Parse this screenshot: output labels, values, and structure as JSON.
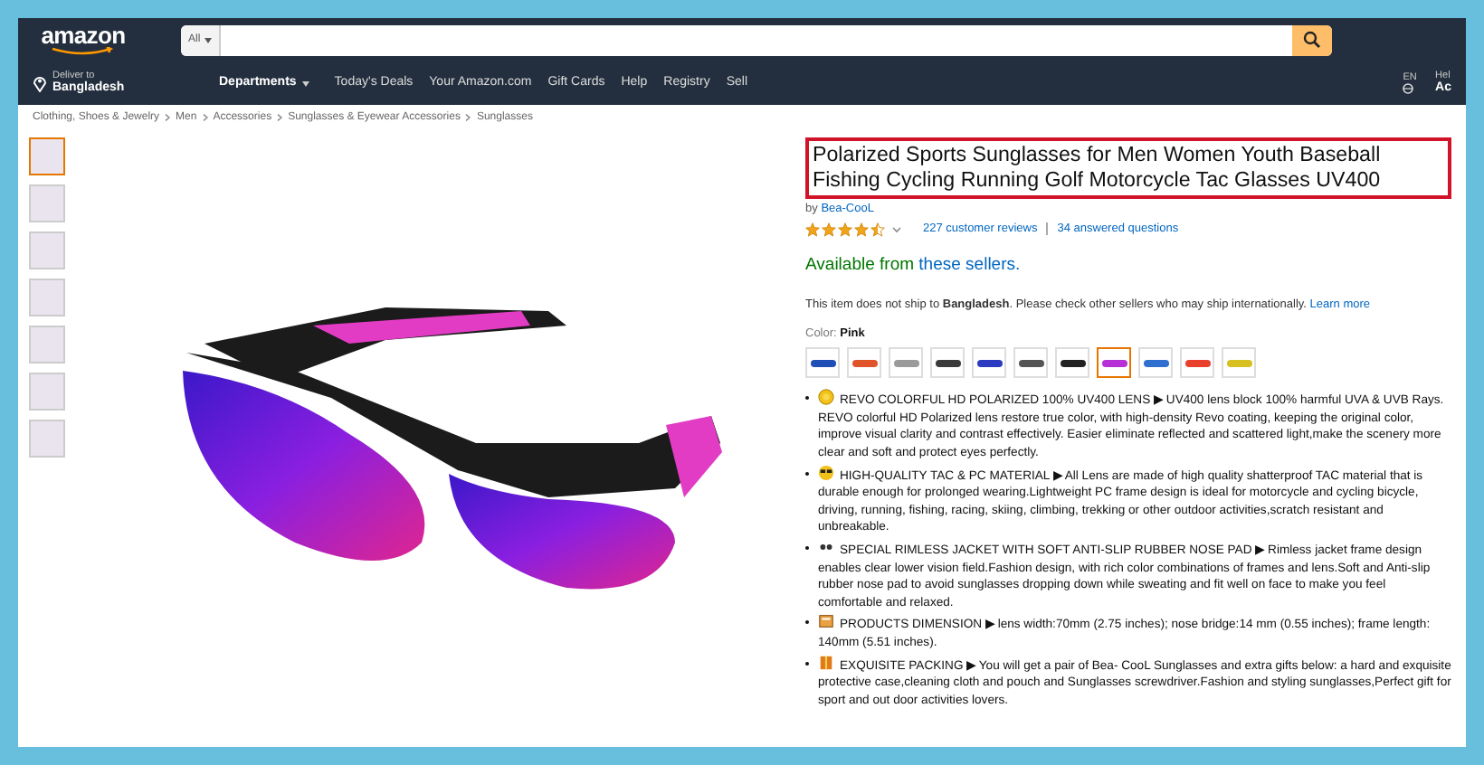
{
  "header": {
    "logo": "amazon",
    "search": {
      "category": "All"
    },
    "deliver": {
      "label": "Deliver to",
      "place": "Bangladesh"
    },
    "departments": "Departments",
    "links": [
      "Today's Deals",
      "Your Amazon.com",
      "Gift Cards",
      "Help",
      "Registry",
      "Sell"
    ],
    "language": "EN",
    "account_line_1": "Hel",
    "account_line_2": "Ac"
  },
  "breadcrumb": [
    "Clothing, Shoes & Jewelry",
    "Men",
    "Accessories",
    "Sunglasses & Eyewear Accessories",
    "Sunglasses"
  ],
  "thumbnails": [
    {
      "selected": true
    },
    {
      "selected": false
    },
    {
      "selected": false
    },
    {
      "selected": false
    },
    {
      "selected": false
    },
    {
      "selected": false
    },
    {
      "selected": false
    }
  ],
  "product": {
    "title": "Polarized Sports Sunglasses for Men Women Youth Baseball Fishing Cycling Running Golf Motorcycle Tac Glasses UV400",
    "title_highlighted": true,
    "brand_prefix": "by",
    "brand": "Bea-CooL",
    "stars": 4.5,
    "reviews": "227 customer reviews",
    "questions": "34 answered questions",
    "availability": "Available from",
    "sellers_link": "these sellers.",
    "shipping_note": "This item does not ship to **Bangladesh**. Please check other sellers who may ship internationally.",
    "learn_more": "Learn more",
    "color_label": "Color:",
    "color_value": "Pink",
    "swatches": [
      {
        "color": "#1f4fb5",
        "selected": false
      },
      {
        "color": "#e0542a",
        "selected": false
      },
      {
        "color": "#9a9a9a",
        "selected": false
      },
      {
        "color": "#3a3a3a",
        "selected": false
      },
      {
        "color": "#2a3bc0",
        "selected": false
      },
      {
        "color": "#555555",
        "selected": false
      },
      {
        "color": "#222222",
        "selected": false
      },
      {
        "color": "#b72fd6",
        "selected": true
      },
      {
        "color": "#2f6fd0",
        "selected": false
      },
      {
        "color": "#e8402c",
        "selected": false
      },
      {
        "color": "#d8c020",
        "selected": false
      }
    ],
    "bullets": [
      {
        "kind": "sun",
        "heading": "REVO COLORFUL HD POLARIZED 100% UV400 LENS",
        "arrow": "▶",
        "text": "UV400 lens block 100% harmful UVA & UVB Rays. REVO colorful HD Polarized lens restore true color, with high-density Revo coating, keeping the original color, improve visual clarity and contrast effectively. Easier eliminate reflected and scattered light,make the scenery more clear and soft and protect eyes perfectly."
      },
      {
        "kind": "glasses",
        "heading": "HIGH-QUALITY TAC & PC MATERIAL",
        "arrow": "▶",
        "text": "All Lens are made of high quality shatterproof TAC material that is durable enough for prolonged wearing.Lightweight PC frame design is ideal for motorcycle and cycling bicycle, driving, running, fishing, racing, skiing, climbing, trekking or other outdoor activities,scratch resistant and unbreakable."
      },
      {
        "kind": "dots",
        "heading": "SPECIAL RIMLESS JACKET WITH SOFT ANTI-SLIP RUBBER NOSE PAD",
        "arrow": "▶",
        "text": "Rimless jacket frame design enables clear lower vision field.Fashion design, with rich color combinations of frames and lens.Soft and Anti-slip rubber nose pad to avoid sunglasses dropping down while sweating and fit well on face to make you feel comfortable and relaxed."
      },
      {
        "kind": "box",
        "heading": "PRODUCTS DIMENSION",
        "arrow": "▶",
        "text": "lens width:70mm (2.75 inches); nose bridge:14 mm (0.55 inches); frame length: 140mm (5.51 inches)."
      },
      {
        "kind": "gift",
        "heading": "EXQUISITE PACKING",
        "arrow": "▶",
        "text": "You will get a pair of Bea- CooL Sunglasses and extra gifts below:  a hard and exquisite protective case,cleaning cloth and pouch and Sunglasses screwdriver.Fashion and styling sunglasses,Perfect gift for sport and out door activities lovers."
      }
    ]
  }
}
